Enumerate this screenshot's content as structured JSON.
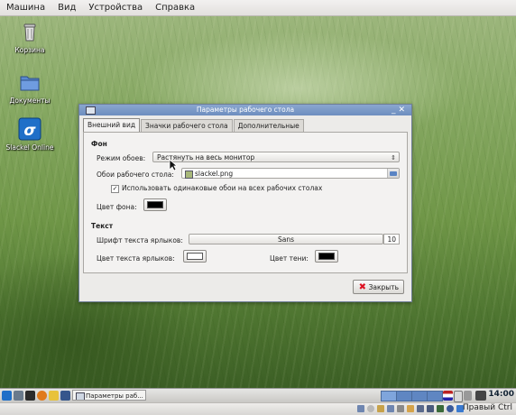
{
  "vbox_menu": [
    "Машина",
    "Вид",
    "Устройства",
    "Справка"
  ],
  "desktop_icons": [
    {
      "label": "Корзина",
      "icon": "trash-icon"
    },
    {
      "label": "Документы",
      "icon": "folder-icon"
    },
    {
      "label": "Slackel Online",
      "icon": "slackel-icon"
    }
  ],
  "dialog": {
    "title": "Параметры рабочего стола",
    "tabs": [
      "Внешний вид",
      "Значки рабочего стола",
      "Дополнительные"
    ],
    "background": {
      "heading": "Фон",
      "mode_label": "Режим обоев:",
      "mode_value": "Растянуть на весь монитор",
      "wallpaper_label": "Обои рабочего стола:",
      "wallpaper_value": "slackel.png",
      "same_wallpaper_label": "Использовать одинаковые обои на всех рабочих столах",
      "same_wallpaper_checked": true,
      "bg_color_label": "Цвет фона:",
      "bg_color": "#000000"
    },
    "text": {
      "heading": "Текст",
      "font_label": "Шрифт текста ярлыков:",
      "font_value": "Sans",
      "font_size": "10",
      "label_color_label": "Цвет текста ярлыков:",
      "label_color": "#ffffff",
      "shadow_color_label": "Цвет тени:",
      "shadow_color": "#000000"
    },
    "close_label": "Закрыть"
  },
  "taskbar": {
    "task_label": "Параметры раб...",
    "clock": "14:00"
  },
  "statusbar": {
    "host_key": "Правый Ctrl"
  }
}
